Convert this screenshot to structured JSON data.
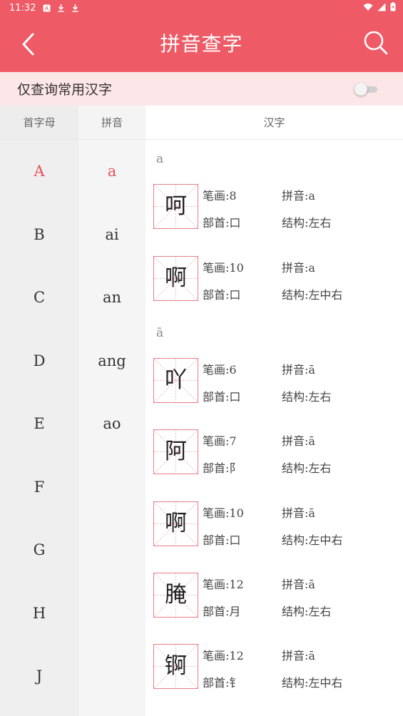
{
  "status": {
    "time": "11:32",
    "icons": [
      "a-notification-icon",
      "download-icon",
      "download-icon"
    ],
    "right_icons": [
      "wifi-icon",
      "signal-icon",
      "battery-icon"
    ]
  },
  "appbar": {
    "title": "拼音查字",
    "back_icon": "chevron-left-icon",
    "search_icon": "search-icon"
  },
  "filter": {
    "label": "仅查询常用汉字",
    "enabled": false
  },
  "headers": {
    "letter": "首字母",
    "pinyin": "拼音",
    "hanzi": "汉字"
  },
  "letters": [
    "A",
    "B",
    "C",
    "D",
    "E",
    "F",
    "G",
    "H",
    "J"
  ],
  "selected_letter": "A",
  "pinyin_list": [
    "a",
    "ai",
    "an",
    "ang",
    "ao"
  ],
  "selected_pinyin": "a",
  "sections": [
    {
      "title": "a",
      "chars": [
        {
          "char": "呵",
          "strokes": "笔画:8",
          "pinyin": "拼音:a",
          "radical": "部首:口",
          "structure": "结构:左右"
        },
        {
          "char": "啊",
          "strokes": "笔画:10",
          "pinyin": "拼音:a",
          "radical": "部首:口",
          "structure": "结构:左中右"
        }
      ]
    },
    {
      "title": "ā",
      "chars": [
        {
          "char": "吖",
          "strokes": "笔画:6",
          "pinyin": "拼音:ā",
          "radical": "部首:口",
          "structure": "结构:左右"
        },
        {
          "char": "阿",
          "strokes": "笔画:7",
          "pinyin": "拼音:ā",
          "radical": "部首:阝",
          "structure": "结构:左右"
        },
        {
          "char": "啊",
          "strokes": "笔画:10",
          "pinyin": "拼音:ā",
          "radical": "部首:口",
          "structure": "结构:左中右"
        },
        {
          "char": "腌",
          "strokes": "笔画:12",
          "pinyin": "拼音:ā",
          "radical": "部首:月",
          "structure": "结构:左右"
        },
        {
          "char": "锕",
          "strokes": "笔画:12",
          "pinyin": "拼音:ā",
          "radical": "部首:钅",
          "structure": "结构:左中右"
        }
      ]
    }
  ],
  "colors": {
    "accent": "#ee5a66",
    "active": "#e8505b",
    "filter_bg": "#fde6e8",
    "grid": "#e77f88"
  }
}
